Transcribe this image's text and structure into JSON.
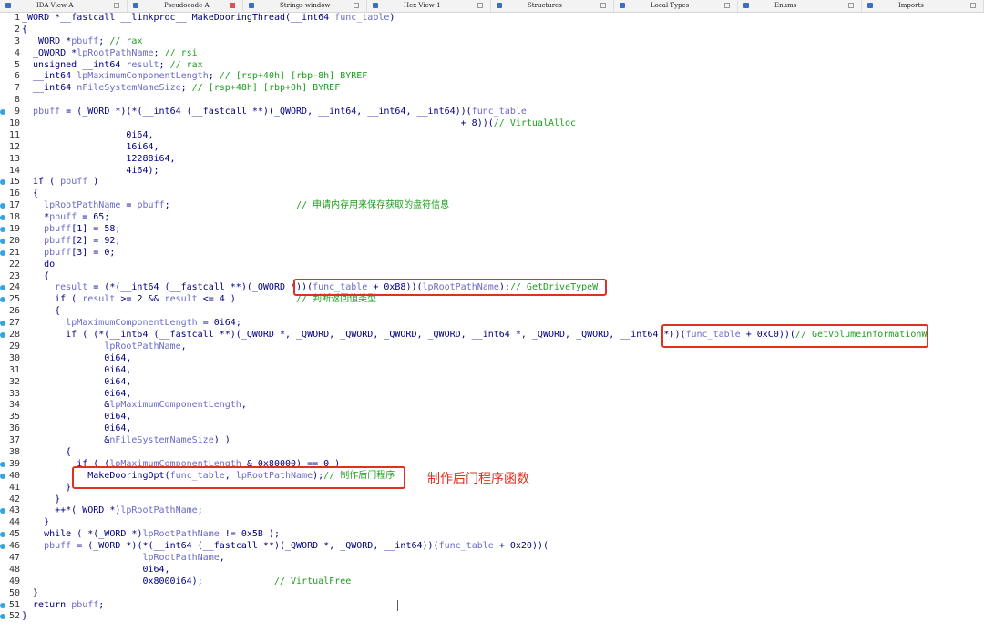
{
  "tabs": [
    {
      "label": "IDA View-A",
      "active": false,
      "width": 140
    },
    {
      "label": "Pseudocode-A",
      "active": true,
      "width": 127
    },
    {
      "label": "Strings window",
      "active": false,
      "width": 136
    },
    {
      "label": "Hex View-1",
      "active": false,
      "width": 136
    },
    {
      "label": "Structures",
      "active": false,
      "width": 135
    },
    {
      "label": "Local Types",
      "active": false,
      "width": 136
    },
    {
      "label": "Enums",
      "active": false,
      "width": 136
    },
    {
      "label": "Imports",
      "active": false,
      "width": 134
    }
  ],
  "code_lines": [
    {
      "n": "1",
      "bp": false,
      "text": "_WORD *__fastcall __linkproc__ MakeDooringThread(__int64 func_table)"
    },
    {
      "n": "2",
      "bp": false,
      "text": "{"
    },
    {
      "n": "3",
      "bp": false,
      "text": "  _WORD *pbuff; // rax"
    },
    {
      "n": "4",
      "bp": false,
      "text": "  _QWORD *lpRootPathName; // rsi"
    },
    {
      "n": "5",
      "bp": false,
      "text": "  unsigned __int64 result; // rax"
    },
    {
      "n": "6",
      "bp": false,
      "text": "  __int64 lpMaximumComponentLength; // [rsp+40h] [rbp-8h] BYREF"
    },
    {
      "n": "7",
      "bp": false,
      "text": "  __int64 nFileSystemNameSize; // [rsp+48h] [rbp+0h] BYREF"
    },
    {
      "n": "8",
      "bp": false,
      "text": ""
    },
    {
      "n": "9",
      "bp": true,
      "text": "  pbuff = (_WORD *)(*(__int64 (__fastcall **)(_QWORD, __int64, __int64, __int64))(func_table"
    },
    {
      "n": "10",
      "bp": false,
      "text": "                                                                                + 8))(// VirtualAlloc"
    },
    {
      "n": "11",
      "bp": false,
      "text": "                   0i64,"
    },
    {
      "n": "12",
      "bp": false,
      "text": "                   16i64,"
    },
    {
      "n": "13",
      "bp": false,
      "text": "                   12288i64,"
    },
    {
      "n": "14",
      "bp": false,
      "text": "                   4i64);"
    },
    {
      "n": "15",
      "bp": true,
      "text": "  if ( pbuff )"
    },
    {
      "n": "16",
      "bp": false,
      "text": "  {"
    },
    {
      "n": "17",
      "bp": true,
      "text": "    lpRootPathName = pbuff;                       // 申请内存用来保存获取的盘符信息"
    },
    {
      "n": "18",
      "bp": true,
      "text": "    *pbuff = 65;"
    },
    {
      "n": "19",
      "bp": true,
      "text": "    pbuff[1] = 58;"
    },
    {
      "n": "20",
      "bp": true,
      "text": "    pbuff[2] = 92;"
    },
    {
      "n": "21",
      "bp": true,
      "text": "    pbuff[3] = 0;"
    },
    {
      "n": "22",
      "bp": false,
      "text": "    do"
    },
    {
      "n": "23",
      "bp": false,
      "text": "    {"
    },
    {
      "n": "24",
      "bp": true,
      "text": "      result = (*(__int64 (__fastcall **)(_QWORD *))(func_table + 0xB8))(lpRootPathName);// GetDriveTypeW"
    },
    {
      "n": "25",
      "bp": true,
      "text": "      if ( result >= 2 && result <= 4 )           // 判断返回值类型"
    },
    {
      "n": "26",
      "bp": false,
      "text": "      {"
    },
    {
      "n": "27",
      "bp": true,
      "text": "        lpMaximumComponentLength = 0i64;"
    },
    {
      "n": "28",
      "bp": true,
      "text": "        if ( (*(__int64 (__fastcall **)(_QWORD *, _QWORD, _QWORD, _QWORD, _QWORD, __int64 *, _QWORD, _QWORD, __int64 *))(func_table + 0xC0))(// GetVolumeInformationW"
    },
    {
      "n": "29",
      "bp": false,
      "text": "               lpRootPathName,"
    },
    {
      "n": "30",
      "bp": false,
      "text": "               0i64,"
    },
    {
      "n": "31",
      "bp": false,
      "text": "               0i64,"
    },
    {
      "n": "32",
      "bp": false,
      "text": "               0i64,"
    },
    {
      "n": "33",
      "bp": false,
      "text": "               0i64,"
    },
    {
      "n": "34",
      "bp": false,
      "text": "               &lpMaximumComponentLength,"
    },
    {
      "n": "35",
      "bp": false,
      "text": "               0i64,"
    },
    {
      "n": "36",
      "bp": false,
      "text": "               0i64,"
    },
    {
      "n": "37",
      "bp": false,
      "text": "               &nFileSystemNameSize) )"
    },
    {
      "n": "38",
      "bp": false,
      "text": "        {"
    },
    {
      "n": "39",
      "bp": true,
      "text": "          if ( (lpMaximumComponentLength & 0x80000) == 0 )"
    },
    {
      "n": "40",
      "bp": true,
      "text": "            MakeDooringOpt(func_table, lpRootPathName);// 制作后门程序"
    },
    {
      "n": "41",
      "bp": false,
      "text": "        }"
    },
    {
      "n": "42",
      "bp": false,
      "text": "      }"
    },
    {
      "n": "43",
      "bp": true,
      "text": "      ++*(_WORD *)lpRootPathName;"
    },
    {
      "n": "44",
      "bp": false,
      "text": "    }"
    },
    {
      "n": "45",
      "bp": true,
      "text": "    while ( *(_WORD *)lpRootPathName != 0x5B );"
    },
    {
      "n": "46",
      "bp": true,
      "text": "    pbuff = (_WORD *)(*(__int64 (__fastcall **)(_QWORD *, _QWORD, __int64))(func_table + 0x20))("
    },
    {
      "n": "47",
      "bp": false,
      "text": "                      lpRootPathName,"
    },
    {
      "n": "48",
      "bp": false,
      "text": "                      0i64,"
    },
    {
      "n": "49",
      "bp": false,
      "text": "                      0x8000i64);             // VirtualFree"
    },
    {
      "n": "50",
      "bp": false,
      "text": "  }"
    },
    {
      "n": "51",
      "bp": true,
      "text": "  return pbuff;"
    },
    {
      "n": "52",
      "bp": true,
      "text": "}"
    }
  ],
  "annotation": "制作后门程序函数",
  "colors": {
    "keyword": "#000080",
    "identifier": "#6a6ac8",
    "comment": "#1f9e1f",
    "highlight_box": "#e0301e",
    "breakpoint_dot": "#35a3e5"
  }
}
